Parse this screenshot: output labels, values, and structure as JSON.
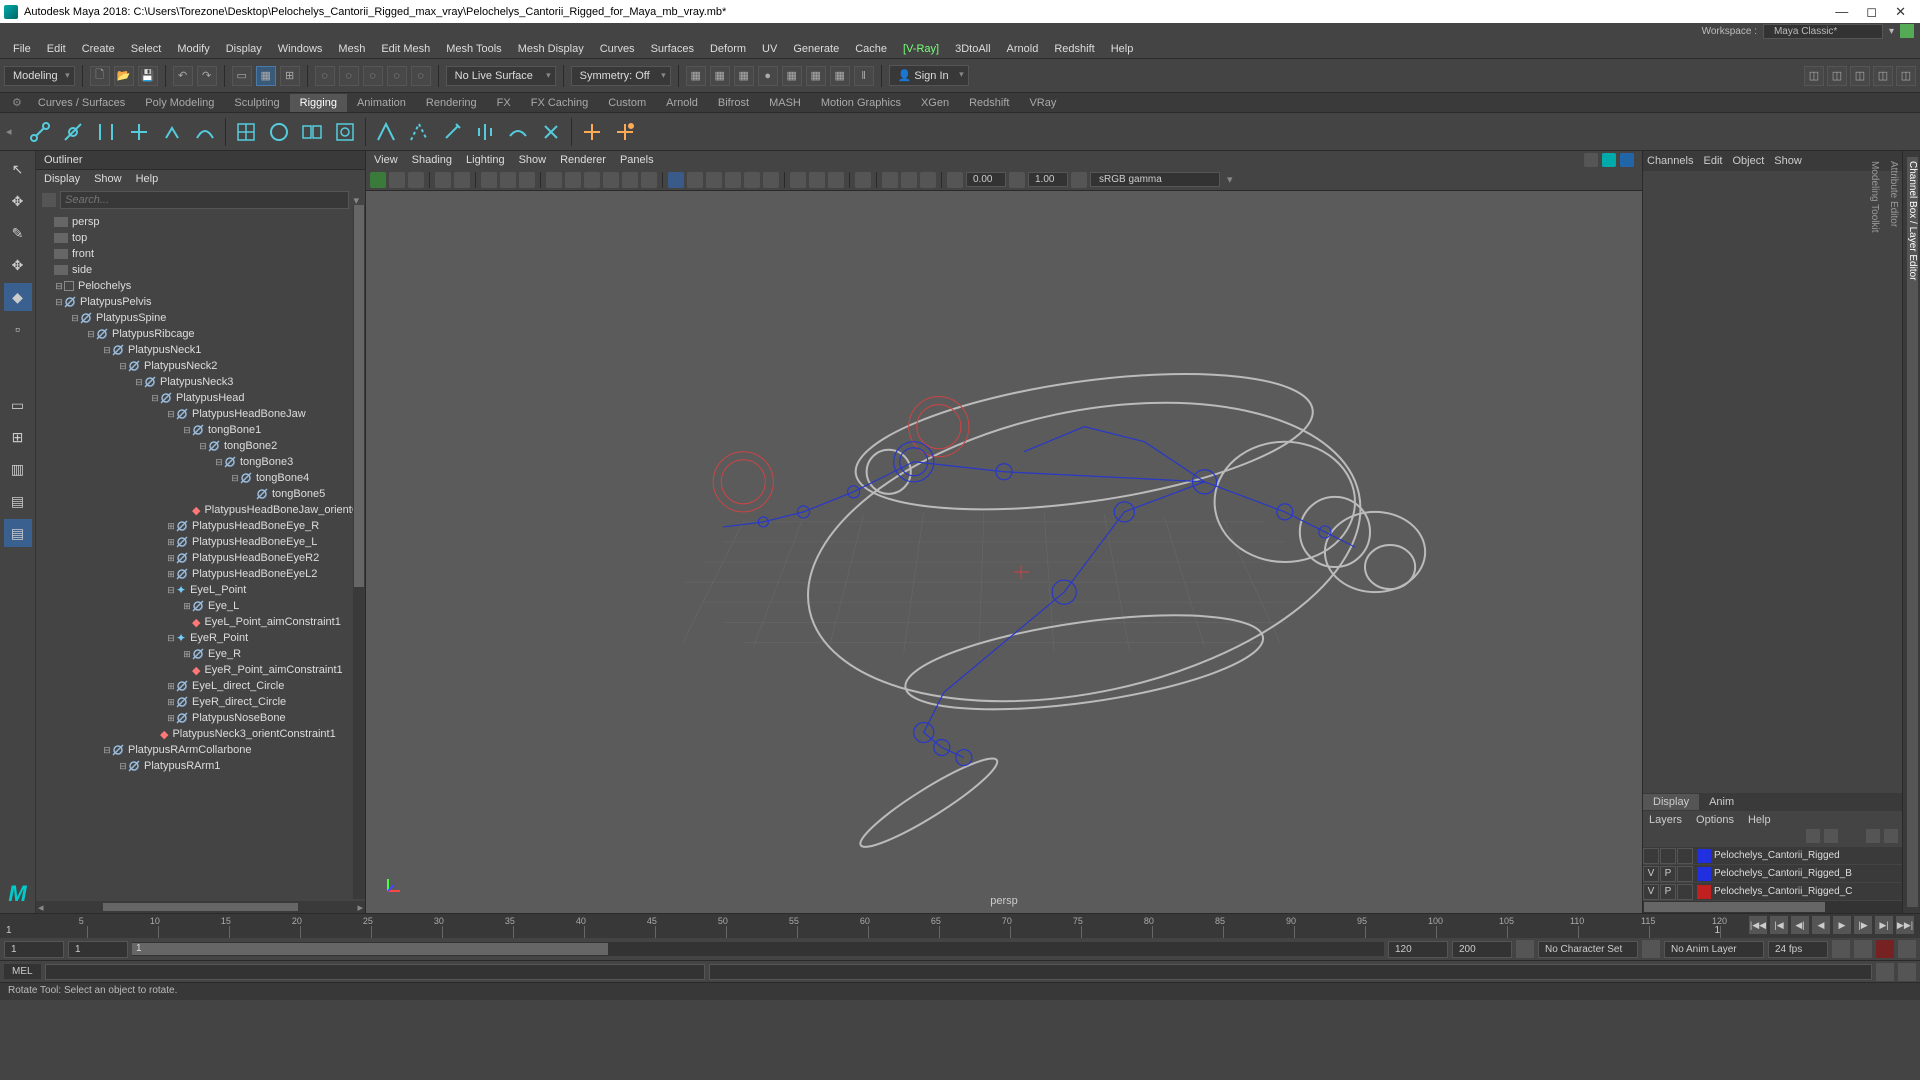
{
  "title": "Autodesk Maya 2018: C:\\Users\\Torezone\\Desktop\\Pelochelys_Cantorii_Rigged_max_vray\\Pelochelys_Cantorii_Rigged_for_Maya_mb_vray.mb*",
  "workspace": {
    "label": "Workspace :",
    "value": "Maya Classic*"
  },
  "menus": [
    "File",
    "Edit",
    "Create",
    "Select",
    "Modify",
    "Display",
    "Windows",
    "Mesh",
    "Edit Mesh",
    "Mesh Tools",
    "Mesh Display",
    "Curves",
    "Surfaces",
    "Deform",
    "UV",
    "Generate",
    "Cache",
    "3DtoAll",
    "Arnold",
    "Redshift",
    "Help"
  ],
  "menu_vray": "[V-Ray]",
  "toolbar": {
    "mode": "Modeling",
    "live": "No Live Surface",
    "sym": "Symmetry: Off",
    "signin": "Sign In"
  },
  "shelf_tabs": [
    "Curves / Surfaces",
    "Poly Modeling",
    "Sculpting",
    "Rigging",
    "Animation",
    "Rendering",
    "FX",
    "FX Caching",
    "Custom",
    "Arnold",
    "Bifrost",
    "MASH",
    "Motion Graphics",
    "XGen",
    "Redshift",
    "VRay"
  ],
  "shelf_active": "Rigging",
  "outliner": {
    "title": "Outliner",
    "menu": [
      "Display",
      "Show",
      "Help"
    ],
    "search_ph": "Search...",
    "cameras": [
      "persp",
      "top",
      "front",
      "side"
    ],
    "tree": [
      {
        "d": 0,
        "t": "trans",
        "n": "Pelochelys",
        "e": "-"
      },
      {
        "d": 0,
        "t": "joint",
        "n": "PlatypusPelvis",
        "e": "-"
      },
      {
        "d": 1,
        "t": "joint",
        "n": "PlatypusSpine",
        "e": "-"
      },
      {
        "d": 2,
        "t": "joint",
        "n": "PlatypusRibcage",
        "e": "-"
      },
      {
        "d": 3,
        "t": "joint",
        "n": "PlatypusNeck1",
        "e": "-"
      },
      {
        "d": 4,
        "t": "joint",
        "n": "PlatypusNeck2",
        "e": "-"
      },
      {
        "d": 5,
        "t": "joint",
        "n": "PlatypusNeck3",
        "e": "-"
      },
      {
        "d": 6,
        "t": "joint",
        "n": "PlatypusHead",
        "e": "-"
      },
      {
        "d": 7,
        "t": "joint",
        "n": "PlatypusHeadBoneJaw",
        "e": "-"
      },
      {
        "d": 8,
        "t": "joint",
        "n": "tongBone1",
        "e": "-"
      },
      {
        "d": 9,
        "t": "joint",
        "n": "tongBone2",
        "e": "-"
      },
      {
        "d": 10,
        "t": "joint",
        "n": "tongBone3",
        "e": "-"
      },
      {
        "d": 11,
        "t": "joint",
        "n": "tongBone4",
        "e": "-"
      },
      {
        "d": 12,
        "t": "joint",
        "n": "tongBone5",
        "e": ""
      },
      {
        "d": 8,
        "t": "con",
        "n": "PlatypusHeadBoneJaw_orientC",
        "e": ""
      },
      {
        "d": 7,
        "t": "joint",
        "n": "PlatypusHeadBoneEye_R",
        "e": "+"
      },
      {
        "d": 7,
        "t": "joint",
        "n": "PlatypusHeadBoneEye_L",
        "e": "+"
      },
      {
        "d": 7,
        "t": "joint",
        "n": "PlatypusHeadBoneEyeR2",
        "e": "+"
      },
      {
        "d": 7,
        "t": "joint",
        "n": "PlatypusHeadBoneEyeL2",
        "e": "+"
      },
      {
        "d": 7,
        "t": "loc",
        "n": "EyeL_Point",
        "e": "-"
      },
      {
        "d": 8,
        "t": "joint",
        "n": "Eye_L",
        "e": "+"
      },
      {
        "d": 8,
        "t": "con",
        "n": "EyeL_Point_aimConstraint1",
        "e": ""
      },
      {
        "d": 7,
        "t": "loc",
        "n": "EyeR_Point",
        "e": "-"
      },
      {
        "d": 8,
        "t": "joint",
        "n": "Eye_R",
        "e": "+"
      },
      {
        "d": 8,
        "t": "con",
        "n": "EyeR_Point_aimConstraint1",
        "e": ""
      },
      {
        "d": 7,
        "t": "joint",
        "n": "EyeL_direct_Circle",
        "e": "+"
      },
      {
        "d": 7,
        "t": "joint",
        "n": "EyeR_direct_Circle",
        "e": "+"
      },
      {
        "d": 7,
        "t": "joint",
        "n": "PlatypusNoseBone",
        "e": "+"
      },
      {
        "d": 6,
        "t": "con",
        "n": "PlatypusNeck3_orientConstraint1",
        "e": ""
      },
      {
        "d": 3,
        "t": "joint",
        "n": "PlatypusRArmCollarbone",
        "e": "-"
      },
      {
        "d": 4,
        "t": "joint",
        "n": "PlatypusRArm1",
        "e": "-"
      }
    ]
  },
  "vp": {
    "menu": [
      "View",
      "Shading",
      "Lighting",
      "Show",
      "Renderer",
      "Panels"
    ],
    "num1": "0.00",
    "num2": "1.00",
    "gamma": "sRGB gamma",
    "label": "persp"
  },
  "chan": {
    "tabs": [
      "Channels",
      "Edit",
      "Object",
      "Show"
    ],
    "ltabs": [
      "Display",
      "Anim"
    ],
    "lmenu": [
      "Layers",
      "Options",
      "Help"
    ],
    "layers": [
      {
        "v": "",
        "p": "",
        "c": "#2030e0",
        "n": "Pelochelys_Cantorii_Rigged"
      },
      {
        "v": "V",
        "p": "P",
        "c": "#2030e0",
        "n": "Pelochelys_Cantorii_Rigged_B"
      },
      {
        "v": "V",
        "p": "P",
        "c": "#c02020",
        "n": "Pelochelys_Cantorii_Rigged_C"
      }
    ]
  },
  "rtabs": [
    "Channel Box / Layer Editor",
    "Attribute Editor",
    "Modeling Toolkit"
  ],
  "tl": {
    "cur": "1",
    "end_vis": "1",
    "ticks": [
      5,
      10,
      15,
      20,
      25,
      30,
      35,
      40,
      45,
      50,
      55,
      60,
      65,
      70,
      75,
      80,
      85,
      90,
      95,
      100,
      105,
      110,
      115,
      120
    ],
    "start": "1",
    "slider_start": "1",
    "range_start": "1",
    "range_end": "120",
    "total_start": "120",
    "total_end": "200",
    "charset": "No Character Set",
    "animlayer": "No Anim Layer",
    "fps": "24 fps"
  },
  "cmd": {
    "lang": "MEL"
  },
  "help": "Rotate Tool: Select an object to rotate."
}
